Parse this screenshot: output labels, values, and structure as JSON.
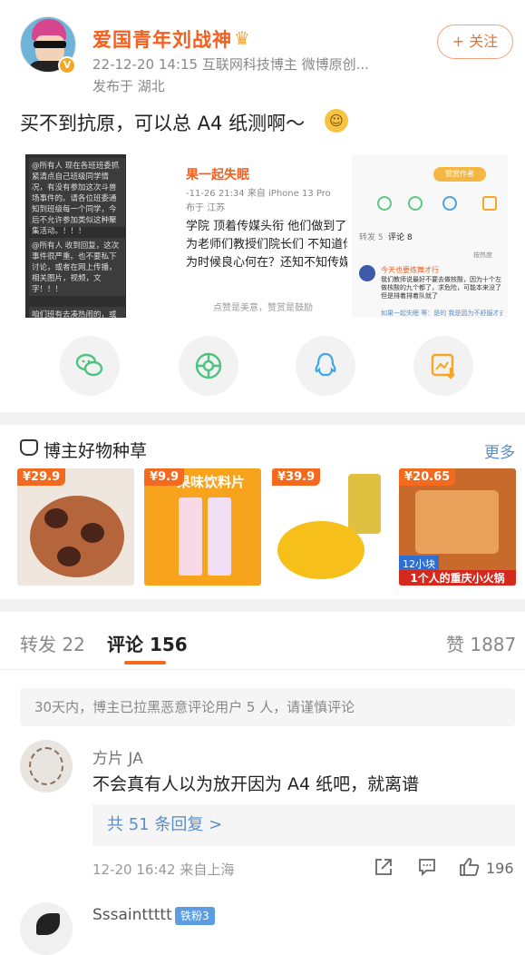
{
  "header": {
    "username": "爱国青年刘战神",
    "verified_badge": "V",
    "crown_icon": "crown-icon",
    "meta": "22-12-20 14:15  互联网科技博主 微博原创...",
    "location": "发布于 湖北",
    "follow_label": "+ 关注"
  },
  "post": {
    "text": "买不到抗原，可以总 A4 纸测啊～",
    "emoji": "☺",
    "image1": {
      "msg1": "@所有人 现在各班班委抓紧清点自己班级同学情况，有没有参加这次斗兽场事件的。请各位班委通知到班级每一个同学，今后不允许参加类似这种聚集活动。！！！",
      "msg2": "@所有人 收到回复，这次事件很严重。也不要私下讨论，或者在网上传播，相关图片，视频，文字！！！",
      "msg3": "咱们班有去凑热闹的，或者参与"
    },
    "image2": {
      "name": "果一起失眠",
      "meta": "-11-26 21:34  来自 iPhone 13 Pro",
      "loc": "布于 江苏",
      "line1": "学院 顶着传媒头衔 他们做到了",
      "line2": "为老师们教授们院长们 不知道你",
      "line3": "为时候良心何在？还知不知传媒",
      "footer": "点赞是美意，赞赏是鼓励"
    },
    "image3": {
      "tag": "赞赏作者",
      "tab1": "转发 5",
      "tab2": "评论 8",
      "sort": "按热度",
      "commenter": "今天也要练舞才行",
      "comment": "我们教师说最好不要去做核酸，因为十个左做核酸的九个都了，求危险，可能本来没了但是排着排着队就了",
      "reply": "如果一起失眠 等：是的 我是因为不舒服才去"
    }
  },
  "share": {
    "icons": [
      "wechat-icon",
      "moments-icon",
      "qq-icon",
      "save-image-icon"
    ]
  },
  "products": {
    "title": "博主好物种草",
    "more": "更多",
    "items": [
      {
        "price": "¥29.9",
        "name": "dried-persimmon"
      },
      {
        "price": "¥9.9",
        "name": "fruit-drink-tablets",
        "caption": "果味饮料片"
      },
      {
        "price": "¥39.9",
        "name": "yellow-peach-can"
      },
      {
        "price": "¥20.65",
        "name": "hotpot",
        "caption1": "12小块",
        "caption2": "1个人的重庆小火锅"
      }
    ]
  },
  "tabs": {
    "repost": "转发 22",
    "comment": "评论 156",
    "like": "赞 1887"
  },
  "notice": "30天内，博主已拉黑恶意评论用户 5 人，请谨慎评论",
  "comments": [
    {
      "name": "方片 JA",
      "text": "不会真有人以为放开因为 A4 纸吧，就离谱",
      "replies": "共 51 条回复 >",
      "meta": "12-20 16:42  来自上海",
      "likes": "196"
    },
    {
      "name": "Sssainttttt",
      "badge": "铁粉3"
    }
  ],
  "colors": {
    "accent": "#f36a1e",
    "username": "#f55e1d",
    "link": "#5b8ec7"
  }
}
